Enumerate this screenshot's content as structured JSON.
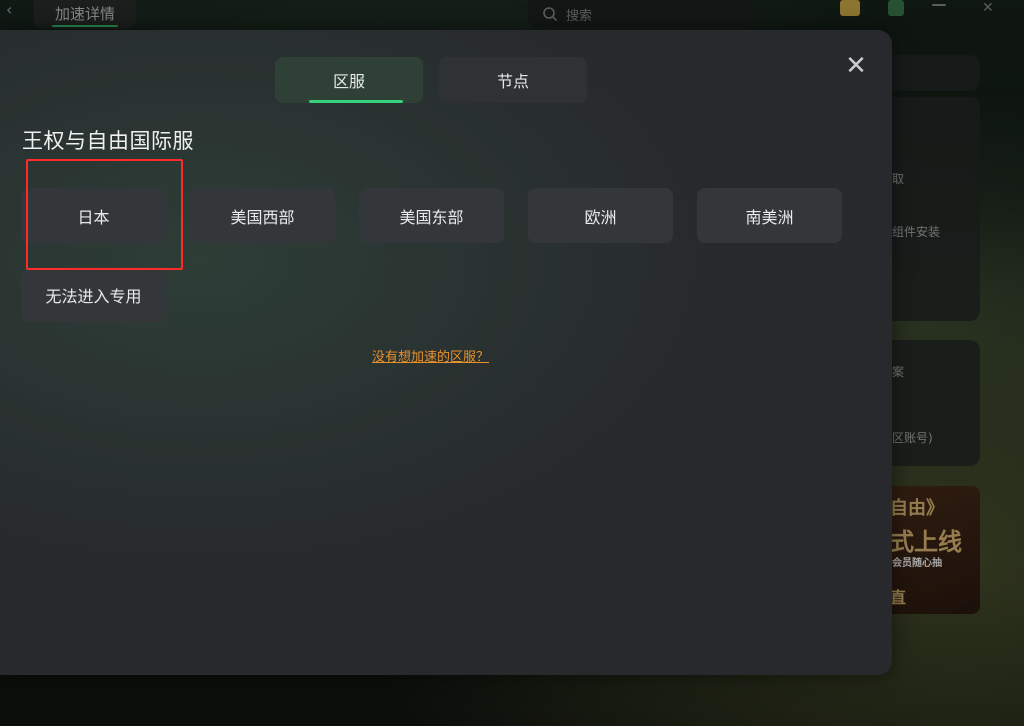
{
  "background": {
    "back_arrow": "‹",
    "tab_label": "加速详情",
    "search_placeholder": "搜索",
    "card_texts": [
      "取",
      "组件安装",
      "案",
      "区账号)"
    ],
    "promo_lines": [
      "自由》",
      "式上线",
      "会员随心抽",
      "直"
    ]
  },
  "modal": {
    "close_label": "✕",
    "tabs": [
      {
        "label": "区服",
        "active": true
      },
      {
        "label": "节点",
        "active": false
      }
    ],
    "game_title": "王权与自由国际服",
    "regions": [
      "日本",
      "美国西部",
      "美国东部",
      "欧洲",
      "南美洲",
      "无法进入专用"
    ],
    "help_link": "没有想加速的区服？"
  },
  "colors": {
    "accent_green": "#36d27a",
    "highlight_red": "#ff2b2b",
    "link_orange": "#e8912c"
  }
}
